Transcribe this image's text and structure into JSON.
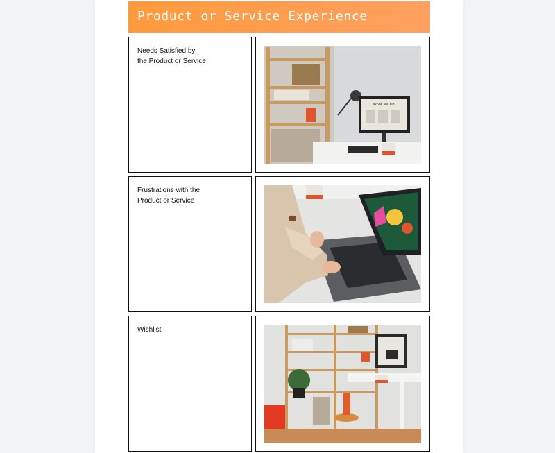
{
  "header": {
    "title": "Product or Service Experience"
  },
  "rows": [
    {
      "label": "Needs Satisfied by\nthe Product or Service"
    },
    {
      "label": "Frustrations with the\nProduct or Service"
    },
    {
      "label": "Wishlist"
    }
  ],
  "photos": {
    "workspace_monitor": {
      "screen_text": "What We Do."
    },
    "laptop_typing": {
      "screen_text": ""
    },
    "office_shelving": {
      "screen_text": ""
    }
  }
}
